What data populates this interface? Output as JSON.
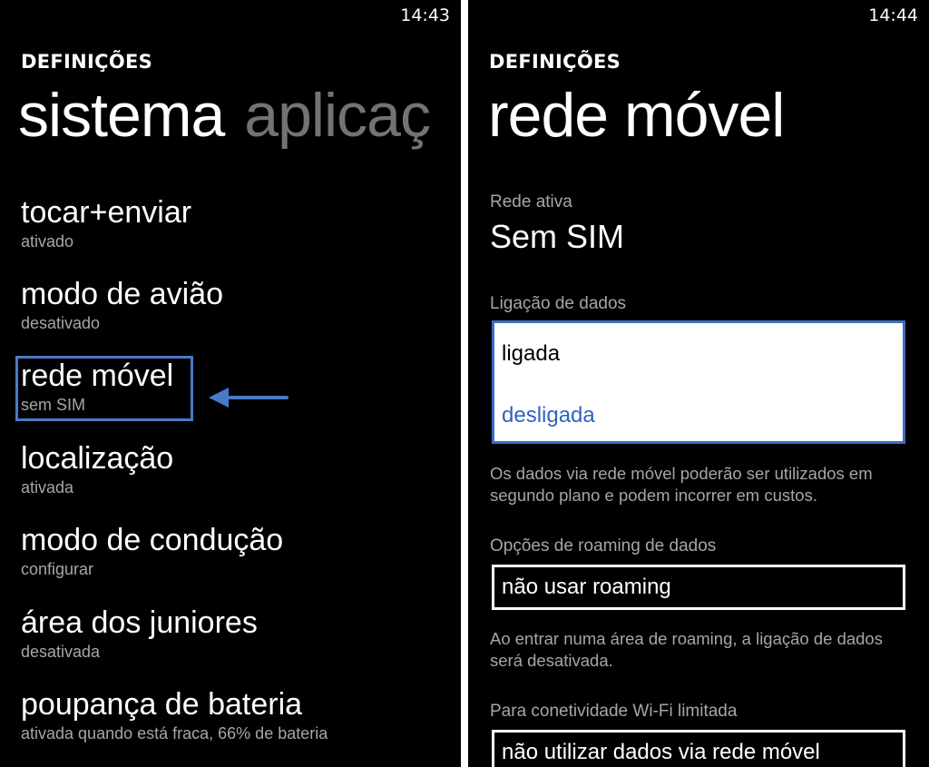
{
  "left": {
    "clock": "14:43",
    "app_title": "DEFINIÇÕES",
    "pivot": {
      "active": "sistema",
      "next": "aplicaç"
    },
    "items": [
      {
        "title": "tocar+enviar",
        "subtitle": "ativado"
      },
      {
        "title": "modo de avião",
        "subtitle": "desativado"
      },
      {
        "title": "rede móvel",
        "subtitle": "sem SIM"
      },
      {
        "title": "localização",
        "subtitle": "ativada"
      },
      {
        "title": "modo de condução",
        "subtitle": "configurar"
      },
      {
        "title": "área dos juniores",
        "subtitle": "desativada"
      },
      {
        "title": "poupança de bateria",
        "subtitle": "ativada quando está fraca, 66% de bateria"
      }
    ],
    "annotation_color": "#4a79c8"
  },
  "right": {
    "clock": "14:44",
    "app_title": "DEFINIÇÕES",
    "page_title": "rede móvel",
    "active_network": {
      "label": "Rede ativa",
      "value": "Sem SIM"
    },
    "data_connection": {
      "label": "Ligação de dados",
      "options": [
        "ligada",
        "desligada"
      ],
      "selected": "desligada",
      "description": "Os dados via rede móvel poderão ser utilizados em segundo plano e podem incorrer em custos."
    },
    "roaming": {
      "label": "Opções de roaming de dados",
      "value": "não usar roaming",
      "description": "Ao entrar numa área de roaming, a ligação de dados será desativada."
    },
    "wifi_limited": {
      "label": "Para conetividade Wi-Fi limitada",
      "value": "não utilizar dados via rede móvel"
    },
    "accent_color": "#2f64c0"
  }
}
